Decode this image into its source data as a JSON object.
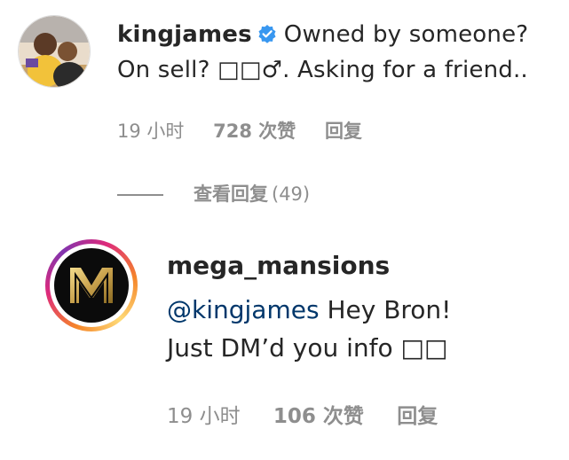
{
  "comments": [
    {
      "username": "kingjames",
      "verified": true,
      "text_line1": "Owned by someone?",
      "text_line2": "On sell? □□♂. Asking for a friend..",
      "time": "19 小时",
      "likes": "728 次赞",
      "reply_label": "回复"
    }
  ],
  "view_replies": {
    "label": "查看回复",
    "count": "(49)"
  },
  "reply": {
    "username": "mega_mansions",
    "mention": "@kingjames",
    "text_line1_rest": " Hey Bron!",
    "text_line2": "Just DM’d you info □□",
    "time": "19 小时",
    "likes": "106 次赞",
    "reply_label": "回复"
  },
  "colors": {
    "verified_badge": "#3897f0",
    "mention": "#00376b",
    "meta_text": "#8e8e8e",
    "brand_gold": "#c9a24d"
  },
  "icons": {
    "verified": "verified-badge-icon"
  }
}
